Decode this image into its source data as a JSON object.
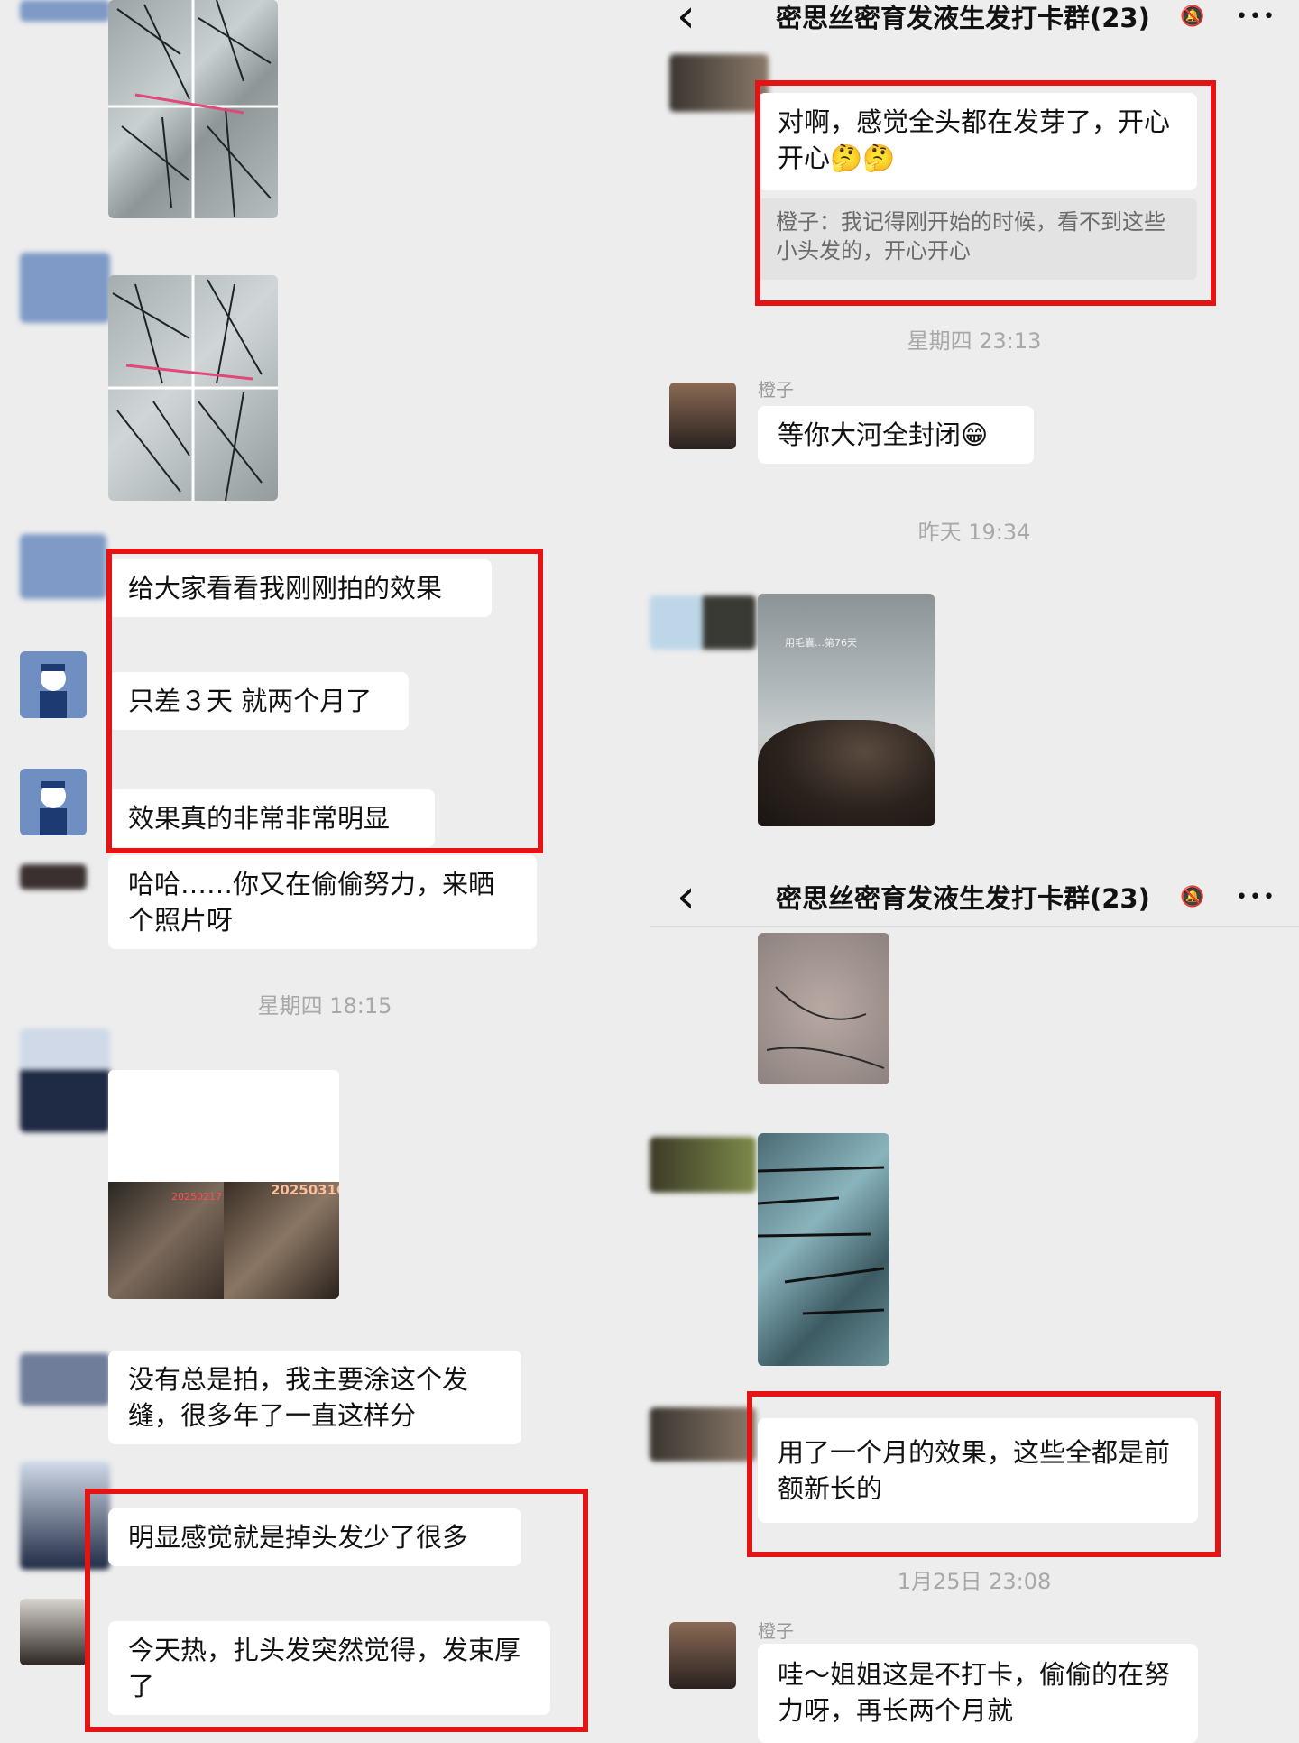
{
  "left": {
    "messages": [
      {
        "text": "给大家看看我刚刚拍的效果"
      },
      {
        "text": "只差３天 就两个月了"
      },
      {
        "text": "效果真的非常非常明显"
      },
      {
        "text": "哈哈……你又在偷偷努力，来晒个照片呀"
      },
      {
        "text": "没有总是拍，我主要涂这个发缝，很多年了一直这样分"
      },
      {
        "text": "明显感觉就是掉头发少了很多"
      },
      {
        "text": "今天热，扎头发突然觉得，发束厚了"
      }
    ],
    "timestamp_1": "星期四 18:15",
    "photo_dates": [
      "20250217",
      "2025031C"
    ]
  },
  "right": {
    "chat_title": "密思丝密育发液生发打卡群(23)",
    "more_label": "•••",
    "back_label": "‹",
    "msg_1": "对啊，感觉全头都在发芽了，开心开心🤔🤔",
    "quote_1": "橙子：我记得刚开始的时候，看不到这些小头发的，开心开心",
    "timestamp_1": "星期四 23:13",
    "sender_1": "橙子",
    "msg_2": "等你大河全封闭😁",
    "timestamp_2": "昨天 19:34",
    "photo_caption": "用毛囊…第76天",
    "msg_3": "用了一个月的效果，这些全都是前额新长的",
    "timestamp_3": "1月25日 23:08",
    "sender_2": "橙子",
    "msg_4": "哇～姐姐这是不打卡，偷偷的在努力呀，再长两个月就"
  },
  "colors": {
    "highlight": "#e41414",
    "bubble": "#ffffff",
    "background": "#ededed"
  }
}
